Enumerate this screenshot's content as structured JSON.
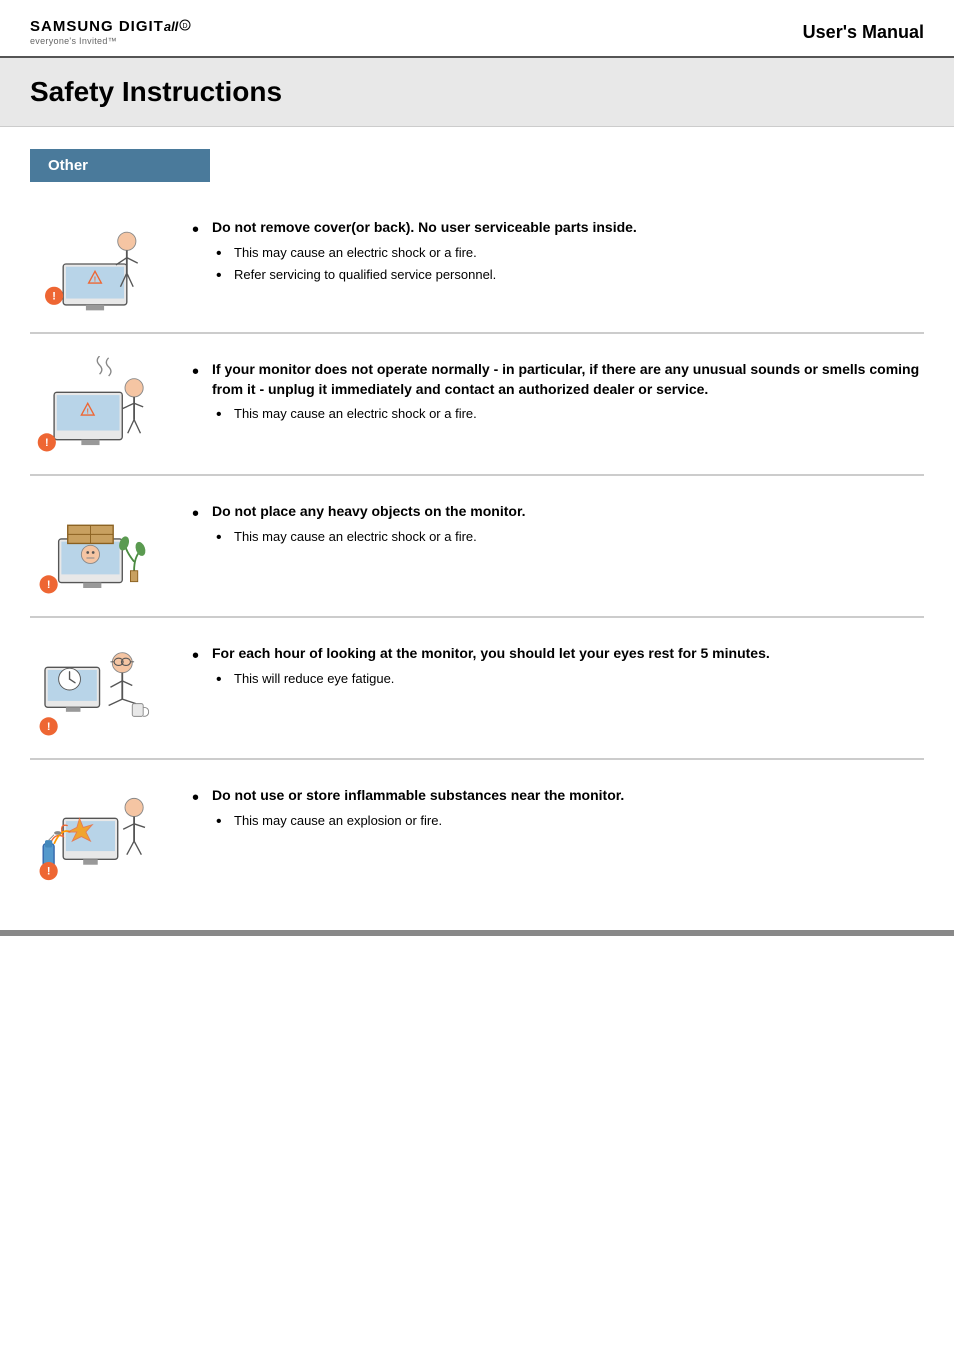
{
  "header": {
    "logo_line1": "SAMSUNG DIGIT",
    "logo_digit_italic": "all",
    "logo_tagline": "everyone's Invited™",
    "title": "User's Manual"
  },
  "page_title": "Safety Instructions",
  "section_label": "Other",
  "instructions": [
    {
      "id": 1,
      "icon_label": "monitor-warning-cover-icon",
      "main_text": "Do not remove cover(or back). No user serviceable parts inside.",
      "sub_items": [
        "This may cause an electric shock or a fire.",
        "Refer servicing to qualified service personnel."
      ]
    },
    {
      "id": 2,
      "icon_label": "monitor-warning-sound-icon",
      "main_text": "If your monitor does not operate normally - in particular, if there are any unusual sounds or smells coming from it - unplug it immediately and contact an authorized dealer or service.",
      "sub_items": [
        "This may cause an electric shock or a fire."
      ]
    },
    {
      "id": 3,
      "icon_label": "monitor-heavy-object-icon",
      "main_text": "Do not place any heavy objects on the monitor.",
      "sub_items": [
        "This may cause an electric shock or a fire."
      ]
    },
    {
      "id": 4,
      "icon_label": "eye-rest-icon",
      "main_text": "For each hour of looking at the monitor, you should let your eyes rest for 5 minutes.",
      "sub_items": [
        "This will reduce eye fatigue."
      ]
    },
    {
      "id": 5,
      "icon_label": "flammable-substances-icon",
      "main_text": "Do not use or store inflammable substances near the monitor.",
      "sub_items": [
        "This may cause an explosion or fire."
      ]
    }
  ],
  "footer_bar_color": "#888888"
}
